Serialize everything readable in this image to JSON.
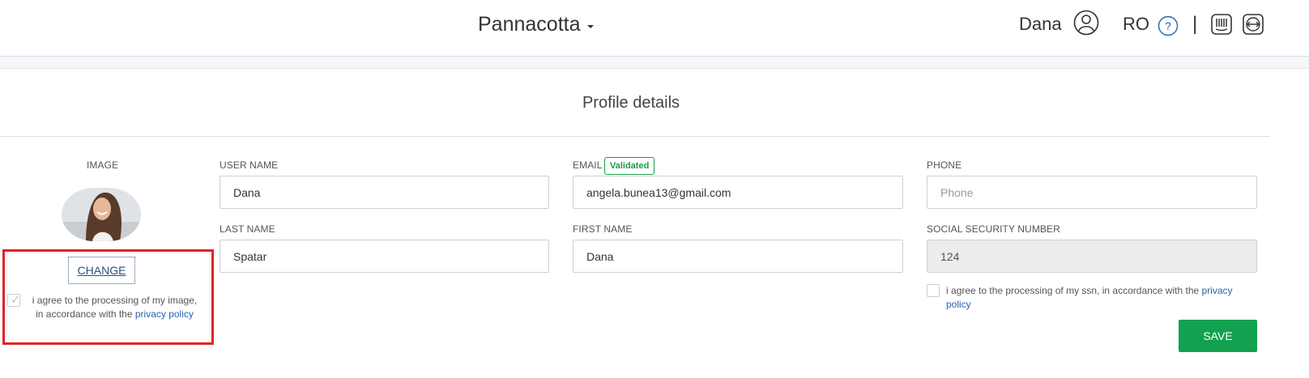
{
  "header": {
    "app_title": "Pannacotta",
    "user_name": "Dana",
    "language": "RO",
    "separator": "|",
    "icons": {
      "user": "user-circle-icon",
      "help": "help-question-icon",
      "tool1": "barcode-icon",
      "tool2": "expand-horizontal-icon"
    }
  },
  "page": {
    "title": "Profile details"
  },
  "image_section": {
    "label": "IMAGE",
    "change_label": "CHANGE",
    "consent_text": "i agree to the processing of my image, in accordance with the",
    "consent_link": "privacy policy",
    "consent_checked": true
  },
  "form": {
    "user_name": {
      "label": "USER NAME",
      "value": "Dana",
      "placeholder": ""
    },
    "email": {
      "label": "EMAIL",
      "badge": "Validated",
      "value": "angela.bunea13@gmail.com",
      "placeholder": ""
    },
    "phone": {
      "label": "PHONE",
      "value": "",
      "placeholder": "Phone"
    },
    "last_name": {
      "label": "LAST NAME",
      "value": "Spatar",
      "placeholder": ""
    },
    "first_name": {
      "label": "FIRST NAME",
      "value": "Dana",
      "placeholder": ""
    },
    "ssn": {
      "label": "SOCIAL SECURITY NUMBER",
      "value": "124",
      "placeholder": ""
    },
    "ssn_consent_text": "i agree to the processing of my ssn, in accordance with the",
    "ssn_consent_link": "privacy policy",
    "ssn_consent_checked": false
  },
  "actions": {
    "save_label": "SAVE"
  },
  "colors": {
    "accent_green": "#12a150",
    "badge_green": "#1a9c4d",
    "link_blue": "#2a62b1",
    "highlight_red": "#e02424"
  }
}
